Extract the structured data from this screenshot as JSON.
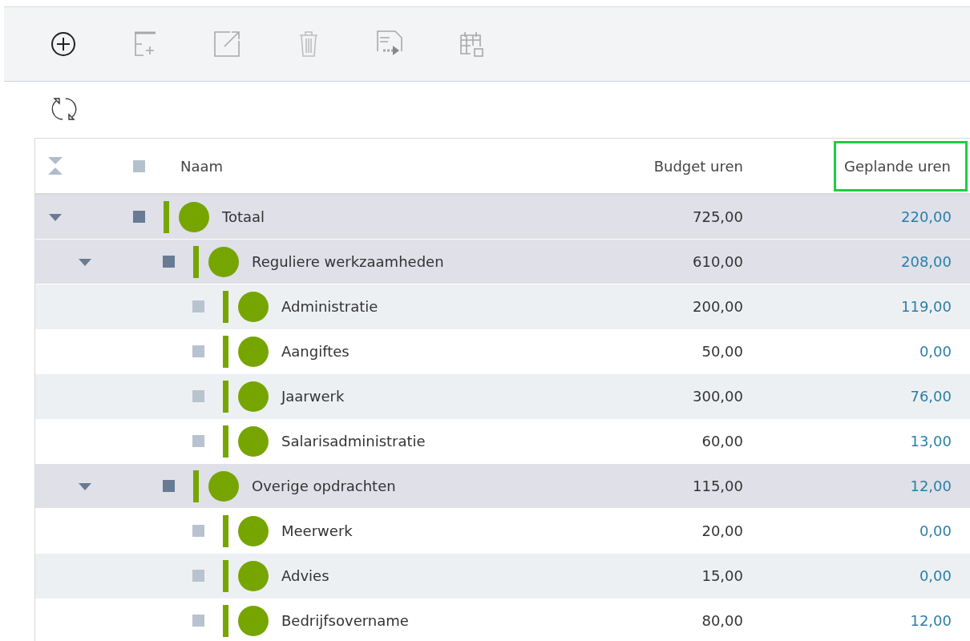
{
  "toolbar": [
    {
      "kind": "add",
      "disabled": false
    },
    {
      "kind": "add-row",
      "disabled": true
    },
    {
      "kind": "open",
      "disabled": true
    },
    {
      "kind": "delete",
      "disabled": true
    },
    {
      "kind": "export",
      "disabled": true
    },
    {
      "kind": "calendar",
      "disabled": true
    }
  ],
  "table": {
    "select_all": {
      "checked": false
    },
    "columns": [
      {
        "label": "Naam",
        "highlighted": false
      },
      {
        "label": "Budget uren",
        "highlighted": false
      },
      {
        "label": "Geplande uren",
        "highlighted": true
      }
    ],
    "rows": [
      {
        "name": "Totaal",
        "budget": "725,00",
        "planned": "220,00",
        "checked": false,
        "expanded": true,
        "children": [
          {
            "name": "Reguliere werkzaamheden",
            "budget": "610,00",
            "planned": "208,00",
            "checked": false,
            "expanded": true,
            "children": [
              {
                "name": "Administratie",
                "budget": "200,00",
                "planned": "119,00",
                "checked": false
              },
              {
                "name": "Aangiftes",
                "budget": "50,00",
                "planned": "0,00",
                "checked": false
              },
              {
                "name": "Jaarwerk",
                "budget": "300,00",
                "planned": "76,00",
                "checked": false
              },
              {
                "name": "Salarisadministratie",
                "budget": "60,00",
                "planned": "13,00",
                "checked": false
              }
            ]
          },
          {
            "name": "Overige opdrachten",
            "budget": "115,00",
            "planned": "12,00",
            "checked": false,
            "expanded": true,
            "children": [
              {
                "name": "Meerwerk",
                "budget": "20,00",
                "planned": "0,00",
                "checked": false
              },
              {
                "name": "Advies",
                "budget": "15,00",
                "planned": "0,00",
                "checked": false
              },
              {
                "name": "Bedrijfsovername",
                "budget": "80,00",
                "planned": "12,00",
                "checked": false
              }
            ]
          }
        ]
      }
    ]
  }
}
